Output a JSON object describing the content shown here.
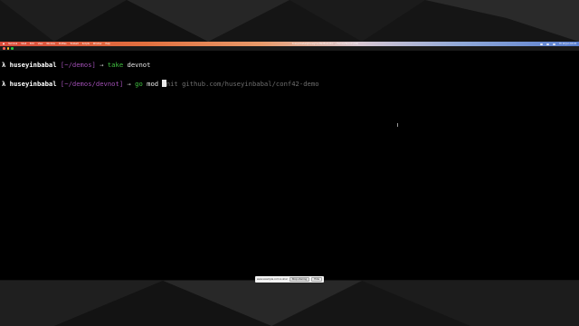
{
  "menubar": {
    "items": [
      "",
      "Terminal",
      "Shell",
      "Edit",
      "View",
      "Window",
      "Profiles",
      "Toolbelt",
      "Scripts",
      "Window",
      "Help"
    ],
    "window_title": "huseyinbabal@huseyins-MacBook-Pro: ~/demos/devnot (zsh)",
    "clock": "Fri 10 Jun 10:24"
  },
  "terminal": {
    "line1": {
      "prompt_symbol": "λ",
      "user": "huseyinbabal",
      "path": "[~/demos]",
      "arrow": "→",
      "command": "take",
      "argument": "devnot"
    },
    "line2": {
      "prompt_symbol": "λ",
      "user": "huseyinbabal",
      "path": "[~/demos/devnot]",
      "arrow": "→",
      "command": "go",
      "typed": "mod",
      "suggestion_partial": "nit",
      "suggestion_rest": "github.com/huseyinbabal/conf42-demo"
    }
  },
  "share_bar": {
    "text": "www.example.com is sharing your screen.",
    "stop_label": "Stop sharing",
    "hide_label": "Hide"
  },
  "colors": {
    "background": "#111111",
    "terminal_bg": "#000000",
    "path": "#a04fb4",
    "command": "#41c241",
    "suggestion": "#6f6f6f"
  }
}
